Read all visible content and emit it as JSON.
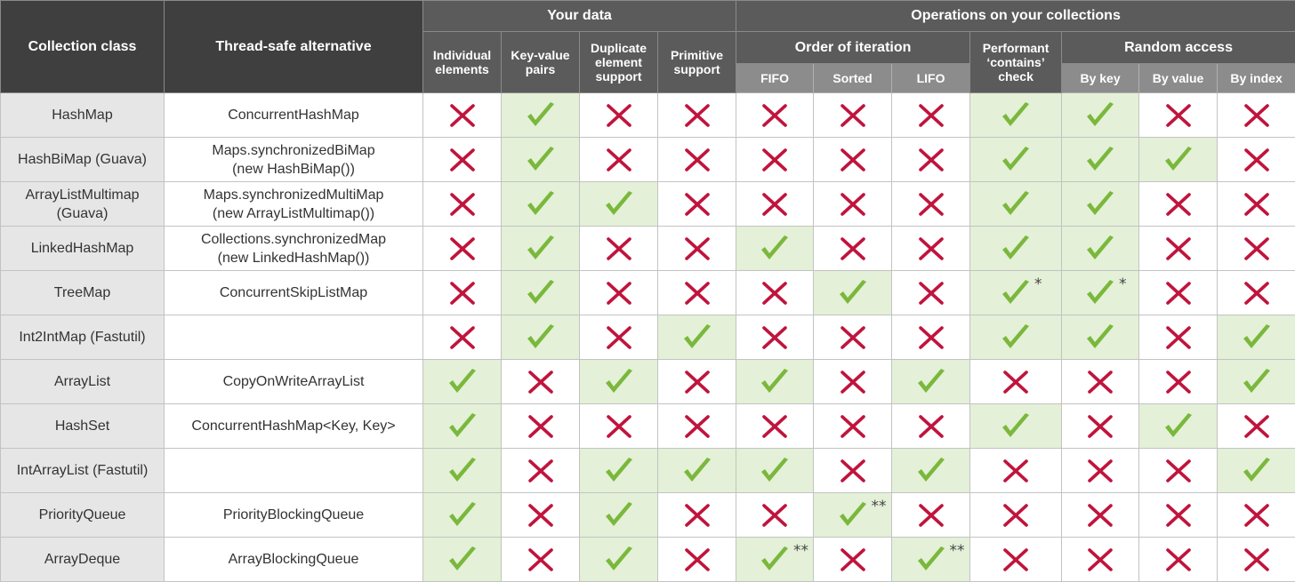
{
  "headers": {
    "collection_class": "Collection class",
    "thread_safe": "Thread-safe alternative",
    "your_data": "Your data",
    "operations": "Operations on your collections",
    "individual": "Individual elements",
    "key_value": "Key-value pairs",
    "duplicate": "Duplicate element support",
    "primitive": "Primitive support",
    "order": "Order of iteration",
    "performant": "Performant ‘contains’ check",
    "random_access": "Random access",
    "fifo": "FIFO",
    "sorted": "Sorted",
    "lifo": "LIFO",
    "by_key": "By key",
    "by_value": "By value",
    "by_index": "By index"
  },
  "colors": {
    "check": "#7ab83c",
    "cross": "#c0143c",
    "yes_bg": "#e4f0d7"
  },
  "icons": {
    "yes": "check-icon",
    "no": "cross-icon"
  },
  "rows": [
    {
      "name": "HashMap",
      "alt": "ConcurrentHashMap",
      "v": [
        0,
        1,
        0,
        0,
        0,
        0,
        0,
        1,
        1,
        0,
        0
      ],
      "n": [
        "",
        "",
        "",
        "",
        "",
        "",
        "",
        "",
        "",
        "",
        ""
      ]
    },
    {
      "name": "HashBiMap (Guava)",
      "alt": "Maps.synchronizedBiMap\n(new HashBiMap())",
      "v": [
        0,
        1,
        0,
        0,
        0,
        0,
        0,
        1,
        1,
        1,
        0
      ],
      "n": [
        "",
        "",
        "",
        "",
        "",
        "",
        "",
        "",
        "",
        "",
        ""
      ]
    },
    {
      "name": "ArrayListMultimap\n(Guava)",
      "alt": "Maps.synchronizedMultiMap\n(new ArrayListMultimap())",
      "v": [
        0,
        1,
        1,
        0,
        0,
        0,
        0,
        1,
        1,
        0,
        0
      ],
      "n": [
        "",
        "",
        "",
        "",
        "",
        "",
        "",
        "",
        "",
        "",
        ""
      ]
    },
    {
      "name": "LinkedHashMap",
      "alt": "Collections.synchronizedMap\n(new LinkedHashMap())",
      "v": [
        0,
        1,
        0,
        0,
        1,
        0,
        0,
        1,
        1,
        0,
        0
      ],
      "n": [
        "",
        "",
        "",
        "",
        "",
        "",
        "",
        "",
        "",
        "",
        ""
      ]
    },
    {
      "name": "TreeMap",
      "alt": "ConcurrentSkipListMap",
      "v": [
        0,
        1,
        0,
        0,
        0,
        1,
        0,
        1,
        1,
        0,
        0
      ],
      "n": [
        "",
        "",
        "",
        "",
        "",
        "",
        "",
        "*",
        "*",
        "",
        ""
      ]
    },
    {
      "name": "Int2IntMap (Fastutil)",
      "alt": "",
      "v": [
        0,
        1,
        0,
        1,
        0,
        0,
        0,
        1,
        1,
        0,
        1
      ],
      "n": [
        "",
        "",
        "",
        "",
        "",
        "",
        "",
        "",
        "",
        "",
        ""
      ]
    },
    {
      "name": "ArrayList",
      "alt": "CopyOnWriteArrayList",
      "v": [
        1,
        0,
        1,
        0,
        1,
        0,
        1,
        0,
        0,
        0,
        1
      ],
      "n": [
        "",
        "",
        "",
        "",
        "",
        "",
        "",
        "",
        "",
        "",
        ""
      ]
    },
    {
      "name": "HashSet",
      "alt": "ConcurrentHashMap<Key, Key>",
      "v": [
        1,
        0,
        0,
        0,
        0,
        0,
        0,
        1,
        0,
        1,
        0
      ],
      "n": [
        "",
        "",
        "",
        "",
        "",
        "",
        "",
        "",
        "",
        "",
        ""
      ]
    },
    {
      "name": "IntArrayList (Fastutil)",
      "alt": "",
      "v": [
        1,
        0,
        1,
        1,
        1,
        0,
        1,
        0,
        0,
        0,
        1
      ],
      "n": [
        "",
        "",
        "",
        "",
        "",
        "",
        "",
        "",
        "",
        "",
        ""
      ]
    },
    {
      "name": "PriorityQueue",
      "alt": "PriorityBlockingQueue",
      "v": [
        1,
        0,
        1,
        0,
        0,
        1,
        0,
        0,
        0,
        0,
        0
      ],
      "n": [
        "",
        "",
        "",
        "",
        "",
        "**",
        "",
        "",
        "",
        "",
        ""
      ]
    },
    {
      "name": "ArrayDeque",
      "alt": "ArrayBlockingQueue",
      "v": [
        1,
        0,
        1,
        0,
        1,
        0,
        1,
        0,
        0,
        0,
        0
      ],
      "n": [
        "",
        "",
        "",
        "",
        "**",
        "",
        "**",
        "",
        "",
        "",
        ""
      ]
    }
  ]
}
